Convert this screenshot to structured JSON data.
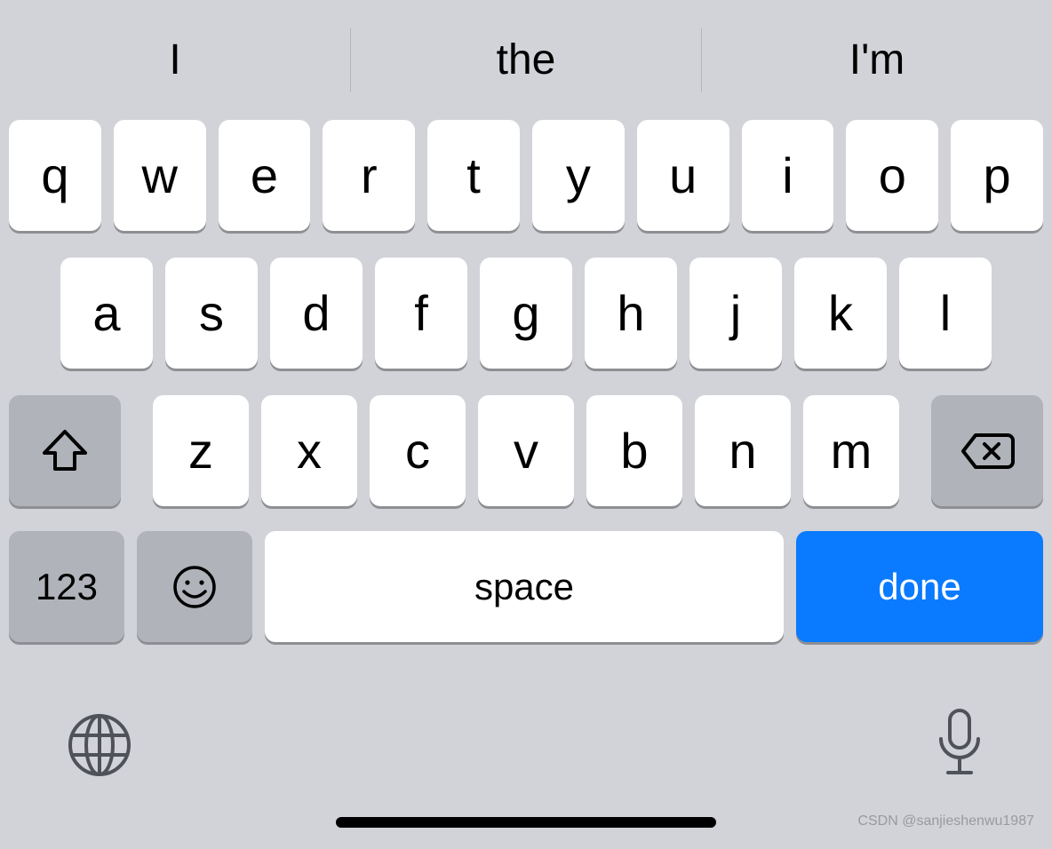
{
  "suggestions": [
    "I",
    "the",
    "I'm"
  ],
  "rows": {
    "r1": [
      "q",
      "w",
      "e",
      "r",
      "t",
      "y",
      "u",
      "i",
      "o",
      "p"
    ],
    "r2": [
      "a",
      "s",
      "d",
      "f",
      "g",
      "h",
      "j",
      "k",
      "l"
    ],
    "r3": [
      "z",
      "x",
      "c",
      "v",
      "b",
      "n",
      "m"
    ]
  },
  "fn": {
    "numbers": "123",
    "space": "space",
    "done": "done"
  },
  "watermark": "CSDN @sanjieshenwu1987"
}
